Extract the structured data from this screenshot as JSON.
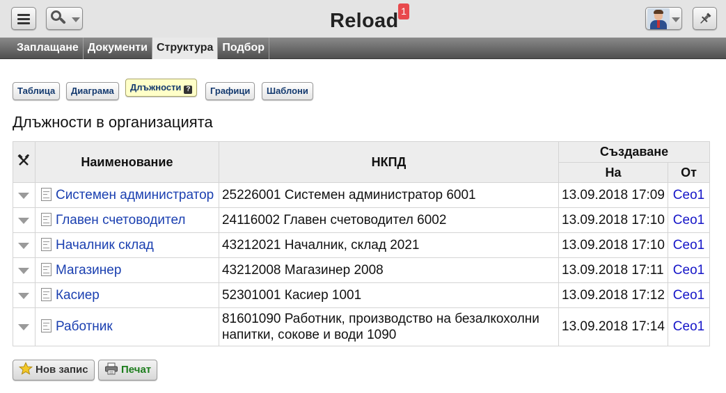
{
  "header": {
    "title": "Reload",
    "notification_count": "1",
    "icons": [
      "menu-icon",
      "search-icon",
      "user-avatar",
      "pin-icon"
    ]
  },
  "nav": {
    "tabs": [
      {
        "label": "Заплащане",
        "active": false
      },
      {
        "label": "Документи",
        "active": false
      },
      {
        "label": "Структура",
        "active": true
      },
      {
        "label": "Подбор",
        "active": false
      }
    ]
  },
  "subtabs": {
    "table": "Таблица",
    "diagram": "Диаграма",
    "positions": "Длъжности",
    "schedules": "Графици",
    "templates": "Шаблони",
    "help_mark": "?"
  },
  "page": {
    "title": "Длъжности в организацията"
  },
  "table": {
    "headers": {
      "name": "Наименование",
      "nkpd": "НКПД",
      "created": "Създаване",
      "on": "На",
      "by": "От"
    },
    "rows": [
      {
        "name": "Системен администратор",
        "nkpd": "25226001 Системен администратор 6001",
        "date": "13.09.2018 17:09",
        "by": "Ceo1"
      },
      {
        "name": "Главен счетоводител",
        "nkpd": "24116002 Главен счетоводител 6002",
        "date": "13.09.2018 17:10",
        "by": "Ceo1"
      },
      {
        "name": "Началник склад",
        "nkpd": "43212021 Началник, склад 2021",
        "date": "13.09.2018 17:10",
        "by": "Ceo1"
      },
      {
        "name": "Магазинер",
        "nkpd": "43212008 Магазинер 2008",
        "date": "13.09.2018 17:11",
        "by": "Ceo1"
      },
      {
        "name": "Касиер",
        "nkpd": "52301001 Касиер 1001",
        "date": "13.09.2018 17:12",
        "by": "Ceo1"
      },
      {
        "name": "Работник",
        "nkpd": "81601090 Работник, производство на безалкохолни напитки, сокове и води 1090",
        "date": "13.09.2018 17:14",
        "by": "Ceo1"
      }
    ]
  },
  "buttons": {
    "new_record": "Нов запис",
    "print": "Печат"
  },
  "colors": {
    "link": "#1a3fb0",
    "active_subtab": "#ffffc8",
    "badge": "#e8494d",
    "print_text": "#1c7d1c"
  }
}
